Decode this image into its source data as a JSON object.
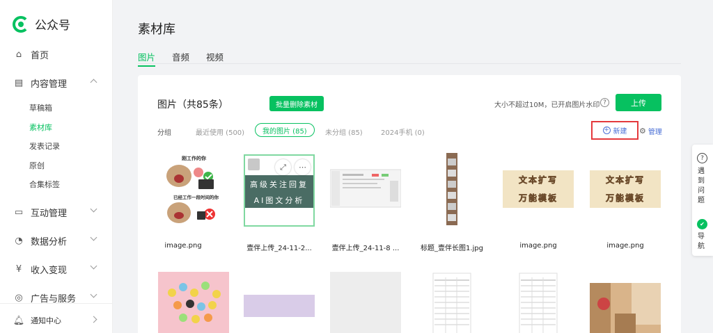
{
  "app": {
    "name": "公众号"
  },
  "sidebar": {
    "items": [
      {
        "label": "首页",
        "icon": "home-icon"
      },
      {
        "label": "内容管理",
        "icon": "document-icon",
        "expanded": true,
        "children": [
          "草稿箱",
          "素材库",
          "发表记录",
          "原创",
          "合集标签"
        ],
        "active_child": "素材库"
      },
      {
        "label": "互动管理",
        "icon": "chat-icon"
      },
      {
        "label": "数据分析",
        "icon": "chart-icon"
      },
      {
        "label": "收入变现",
        "icon": "yuan-icon"
      },
      {
        "label": "广告与服务",
        "icon": "compass-icon"
      }
    ],
    "notification": {
      "label": "通知中心",
      "icon": "bell-icon"
    }
  },
  "page": {
    "title": "素材库",
    "tabs": [
      {
        "label": "图片",
        "active": true
      },
      {
        "label": "音频",
        "active": false
      },
      {
        "label": "视频",
        "active": false
      }
    ]
  },
  "library": {
    "title": "图片（共85条）",
    "batch_delete_label": "批量删除素材",
    "limit_text": "大小不超过10M，已开启图片水印",
    "upload_label": "上传",
    "group_label": "分组",
    "groups": [
      {
        "label": "最近使用 (500)",
        "active": false
      },
      {
        "label": "我的图片 (85)",
        "active": true
      },
      {
        "label": "未分组 (85)",
        "active": false
      },
      {
        "label": "2024手机 (0)",
        "active": false
      }
    ],
    "new_label": "新建",
    "manage_label": "管理",
    "images": [
      {
        "name": "image.png",
        "kind": "meme",
        "top_caption": "刚工作的你",
        "bottom_caption": "已经工作一段时间的你"
      },
      {
        "name": "壹伴上传_24-11-2...",
        "kind": "banner",
        "selected": true,
        "lines": [
          "高级关注回复",
          "AI图文分析"
        ]
      },
      {
        "name": "壹伴上传_24-11-8 ...",
        "kind": "screenshot"
      },
      {
        "name": "标题_壹伴长图1.jpg",
        "kind": "long"
      },
      {
        "name": "image.png",
        "kind": "text-tile",
        "lines": [
          "文本扩写",
          "万能模板"
        ]
      },
      {
        "name": "image.png",
        "kind": "text-tile",
        "lines": [
          "文本扩写",
          "万能模板"
        ]
      }
    ],
    "row2": [
      "pink-illustration",
      "purple-block",
      "blank",
      "table-doc",
      "table-doc",
      "room-photo"
    ]
  },
  "helper": {
    "question_label": "遇到问题",
    "nav_label": "导航",
    "question_icon": "question-icon",
    "nav_icon": "compass-icon"
  },
  "colors": {
    "accent": "#07c160",
    "highlight_border": "#e4393c",
    "link": "#4a6fd6"
  }
}
